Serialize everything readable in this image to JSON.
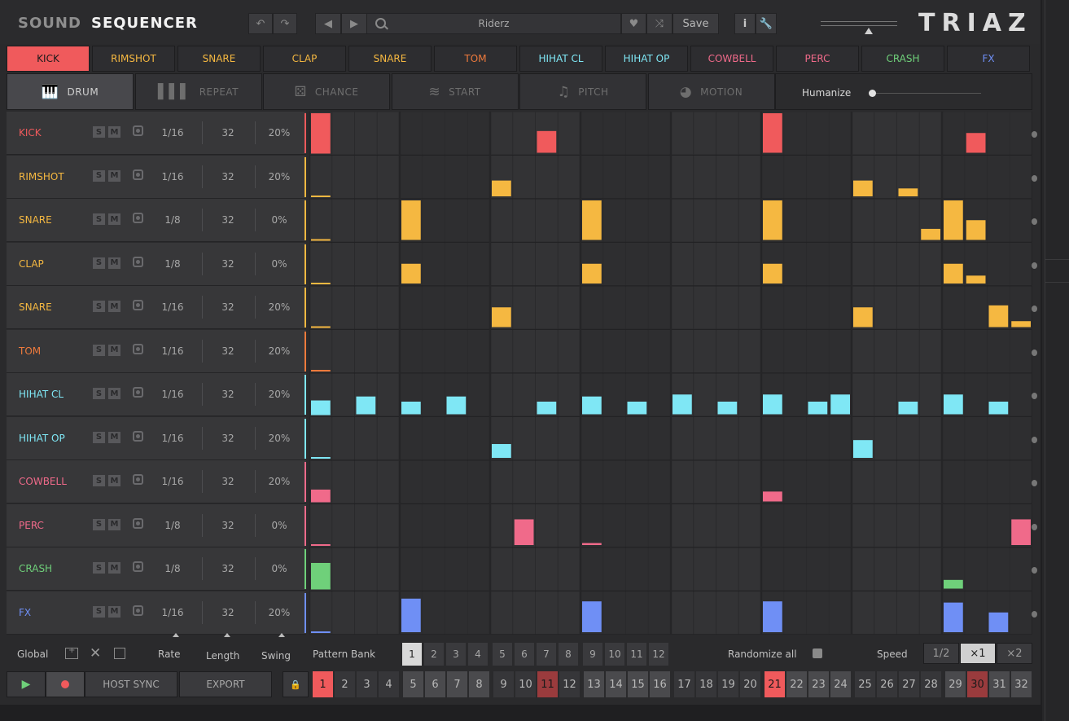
{
  "header": {
    "tab_sound": "SOUND",
    "tab_sequencer": "SEQUENCER",
    "preset_name": "Riderz",
    "save_label": "Save",
    "logo": "TRIAZ"
  },
  "instrument_tabs": [
    {
      "label": "KICK",
      "color": "#f05a5c"
    },
    {
      "label": "RIMSHOT",
      "color": "#f5b841"
    },
    {
      "label": "SNARE",
      "color": "#f5b841"
    },
    {
      "label": "CLAP",
      "color": "#f5b841"
    },
    {
      "label": "SNARE",
      "color": "#f5b841"
    },
    {
      "label": "TOM",
      "color": "#ee7a3c"
    },
    {
      "label": "HIHAT CL",
      "color": "#7fe7f5"
    },
    {
      "label": "HIHAT OP",
      "color": "#7fe7f5"
    },
    {
      "label": "COWBELL",
      "color": "#f06a8a"
    },
    {
      "label": "PERC",
      "color": "#f06a8a"
    },
    {
      "label": "CRASH",
      "color": "#6fd07a"
    },
    {
      "label": "FX",
      "color": "#6f8ff5"
    }
  ],
  "mode_tabs": [
    {
      "label": "DRUM",
      "icon": "piano-icon"
    },
    {
      "label": "REPEAT",
      "icon": "bars-icon"
    },
    {
      "label": "CHANCE",
      "icon": "dice-icon"
    },
    {
      "label": "START",
      "icon": "waveform-icon"
    },
    {
      "label": "PITCH",
      "icon": "note-icon"
    },
    {
      "label": "MOTION",
      "icon": "motion-icon"
    }
  ],
  "humanize": {
    "label": "Humanize",
    "value": 0
  },
  "tracks": [
    {
      "name": "KICK",
      "rate": "1/16",
      "length": "32",
      "swing": "20%",
      "color": "#f05a5c"
    },
    {
      "name": "RIMSHOT",
      "rate": "1/16",
      "length": "32",
      "swing": "20%",
      "color": "#f5b841"
    },
    {
      "name": "SNARE",
      "rate": "1/8",
      "length": "32",
      "swing": "0%",
      "color": "#f5b841"
    },
    {
      "name": "CLAP",
      "rate": "1/8",
      "length": "32",
      "swing": "0%",
      "color": "#f5b841"
    },
    {
      "name": "SNARE",
      "rate": "1/16",
      "length": "32",
      "swing": "20%",
      "color": "#f5b841"
    },
    {
      "name": "TOM",
      "rate": "1/16",
      "length": "32",
      "swing": "20%",
      "color": "#ee7a3c"
    },
    {
      "name": "HIHAT CL",
      "rate": "1/16",
      "length": "32",
      "swing": "20%",
      "color": "#7fe7f5"
    },
    {
      "name": "HIHAT OP",
      "rate": "1/16",
      "length": "32",
      "swing": "20%",
      "color": "#7fe7f5"
    },
    {
      "name": "COWBELL",
      "rate": "1/16",
      "length": "32",
      "swing": "20%",
      "color": "#f06a8a"
    },
    {
      "name": "PERC",
      "rate": "1/8",
      "length": "32",
      "swing": "0%",
      "color": "#f06a8a"
    },
    {
      "name": "CRASH",
      "rate": "1/8",
      "length": "32",
      "swing": "0%",
      "color": "#6fd07a"
    },
    {
      "name": "FX",
      "rate": "1/16",
      "length": "32",
      "swing": "20%",
      "color": "#6f8ff5"
    }
  ],
  "solo_label": "S",
  "mute_label": "M",
  "steps": [
    [
      [
        0,
        1.0
      ],
      [
        10,
        0.55
      ],
      [
        20,
        1.0
      ],
      [
        29,
        0.5
      ]
    ],
    [
      [
        8,
        0.4
      ],
      [
        24,
        0.4
      ],
      [
        26,
        0.2
      ]
    ],
    [
      [
        4,
        1.0
      ],
      [
        12,
        1.0
      ],
      [
        20,
        1.0
      ],
      [
        27,
        0.28
      ],
      [
        28,
        1.0
      ],
      [
        29,
        0.5
      ]
    ],
    [
      [
        4,
        0.5
      ],
      [
        12,
        0.5
      ],
      [
        20,
        0.5
      ],
      [
        28,
        0.5
      ],
      [
        29,
        0.2
      ]
    ],
    [
      [
        8,
        0.5
      ],
      [
        24,
        0.5
      ],
      [
        30,
        0.55
      ],
      [
        31,
        0.15
      ]
    ],
    [],
    [
      [
        0,
        0.35
      ],
      [
        2,
        0.45
      ],
      [
        4,
        0.32
      ],
      [
        6,
        0.45
      ],
      [
        10,
        0.32
      ],
      [
        12,
        0.45
      ],
      [
        14,
        0.32
      ],
      [
        16,
        0.5
      ],
      [
        18,
        0.32
      ],
      [
        20,
        0.5
      ],
      [
        22,
        0.32
      ],
      [
        23,
        0.5
      ],
      [
        26,
        0.32
      ],
      [
        28,
        0.5
      ],
      [
        30,
        0.32
      ]
    ],
    [
      [
        8,
        0.35
      ],
      [
        24,
        0.45
      ]
    ],
    [
      [
        0,
        0.3
      ],
      [
        20,
        0.25
      ]
    ],
    [
      [
        9,
        0.65
      ],
      [
        12,
        0.05
      ],
      [
        31,
        0.65
      ]
    ],
    [
      [
        0,
        0.65
      ],
      [
        28,
        0.22
      ]
    ],
    [
      [
        4,
        0.85
      ],
      [
        12,
        0.78
      ],
      [
        20,
        0.78
      ],
      [
        28,
        0.75
      ],
      [
        30,
        0.5
      ]
    ]
  ],
  "footer": {
    "global_label": "Global",
    "rate_label": "Rate",
    "length_label": "Length",
    "swing_label": "Swing",
    "pattern_bank_label": "Pattern Bank",
    "pattern_bank": [
      "1",
      "2",
      "3",
      "4",
      "5",
      "6",
      "7",
      "8",
      "9",
      "10",
      "11",
      "12"
    ],
    "pattern_bank_selected": "1",
    "randomize_label": "Randomize all",
    "speed_label": "Speed",
    "speed_options": [
      "1/2",
      "×1",
      "×2"
    ],
    "speed_selected": "×1",
    "host_sync_label": "HOST SYNC",
    "export_label": "EXPORT",
    "step_buttons": [
      "1",
      "2",
      "3",
      "4",
      "5",
      "6",
      "7",
      "8",
      "9",
      "10",
      "11",
      "12",
      "13",
      "14",
      "15",
      "16",
      "17",
      "18",
      "19",
      "20",
      "21",
      "22",
      "23",
      "24",
      "25",
      "26",
      "27",
      "28",
      "29",
      "30",
      "31",
      "32"
    ],
    "play_position": "1",
    "current_step": "21",
    "loop_end_markers": [
      "11",
      "30"
    ]
  }
}
